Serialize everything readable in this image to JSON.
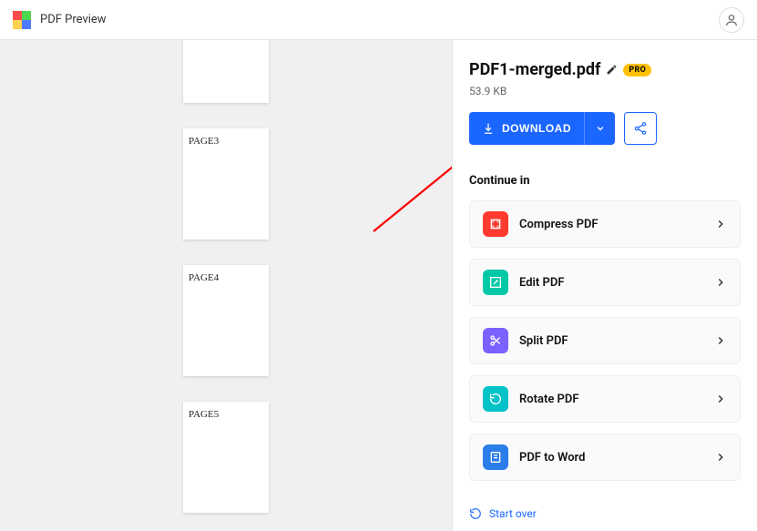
{
  "header": {
    "title": "PDF Preview"
  },
  "preview": {
    "pages": [
      {
        "label": ""
      },
      {
        "label": "PAGE3"
      },
      {
        "label": "PAGE4"
      },
      {
        "label": "PAGE5"
      }
    ]
  },
  "file": {
    "name": "PDF1-merged.pdf",
    "pro_badge": "PRO",
    "size": "53.9 KB"
  },
  "download": {
    "label": "DOWNLOAD"
  },
  "continue": {
    "title": "Continue in",
    "actions": [
      {
        "id": "compress",
        "label": "Compress PDF",
        "color": "#ff3b30"
      },
      {
        "id": "edit",
        "label": "Edit PDF",
        "color": "#00c9a7"
      },
      {
        "id": "split",
        "label": "Split PDF",
        "color": "#7b61ff"
      },
      {
        "id": "rotate",
        "label": "Rotate PDF",
        "color": "#00c2c7"
      },
      {
        "id": "pdf2word",
        "label": "PDF to Word",
        "color": "#2b7de9"
      }
    ]
  },
  "start_over": {
    "label": "Start over"
  }
}
